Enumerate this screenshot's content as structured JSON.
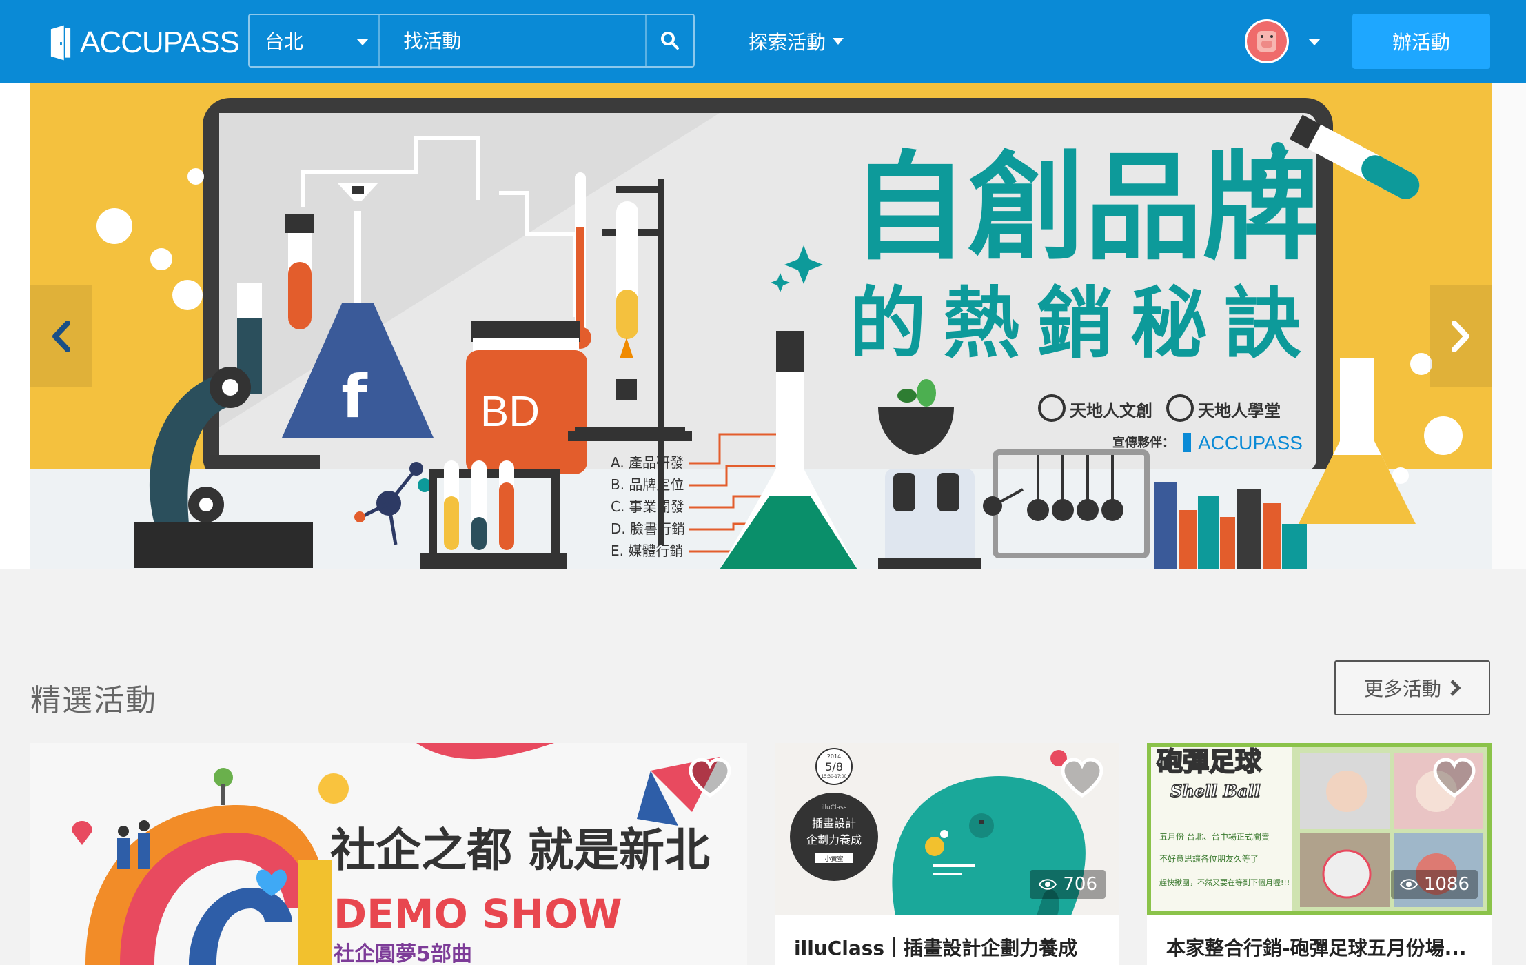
{
  "header": {
    "logo_text": "ACCUPASS",
    "city": "台北",
    "search_placeholder": "找活動",
    "explore_label": "探索活動",
    "host_button": "辦活動",
    "brand_color": "#0a8ad6",
    "host_color": "#1ea7ff"
  },
  "banner": {
    "title_line1": "自創品牌",
    "title_line2": "的熱銷秘訣",
    "org1": "天地人文創",
    "org2": "天地人學堂",
    "partner_label": "宣傳夥伴：",
    "partner_name": "ACCUPASS",
    "jar_label": "BD",
    "checklist": [
      "A. 產品研發",
      "B. 品牌定位",
      "C. 事業開發",
      "D. 臉書行銷",
      "E. 媒體行銷"
    ],
    "accent_color": "#0d9a9a",
    "bg_color": "#f4c13e"
  },
  "featured": {
    "title": "精選活動",
    "more_label": "更多活動",
    "cards": [
      {
        "img_headline": "社企之都 就是新北",
        "img_sub": "DEMO SHOW",
        "img_sub2": "社企圓夢5部曲"
      },
      {
        "title": "illuClass｜插畫設計企劃力養成",
        "views": "706",
        "img_date_year": "2014",
        "img_date": "5/8",
        "img_time": "15:30-17:00",
        "img_brand": "illuClass",
        "img_text1": "插畫設計",
        "img_text2": "企劃力養成",
        "img_text3": "小黃蜜"
      },
      {
        "title": "本家整合行銷-砲彈足球五月份場...",
        "views": "1086",
        "img_title": "砲彈足球",
        "img_subtitle": "Shell Ball",
        "img_line1": "五月份 台北、台中場正式開賣",
        "img_line2": "不好意思讓各位朋友久等了",
        "img_line3": "趕快揪團，不然又要在等到下個月喔!!!"
      }
    ]
  }
}
